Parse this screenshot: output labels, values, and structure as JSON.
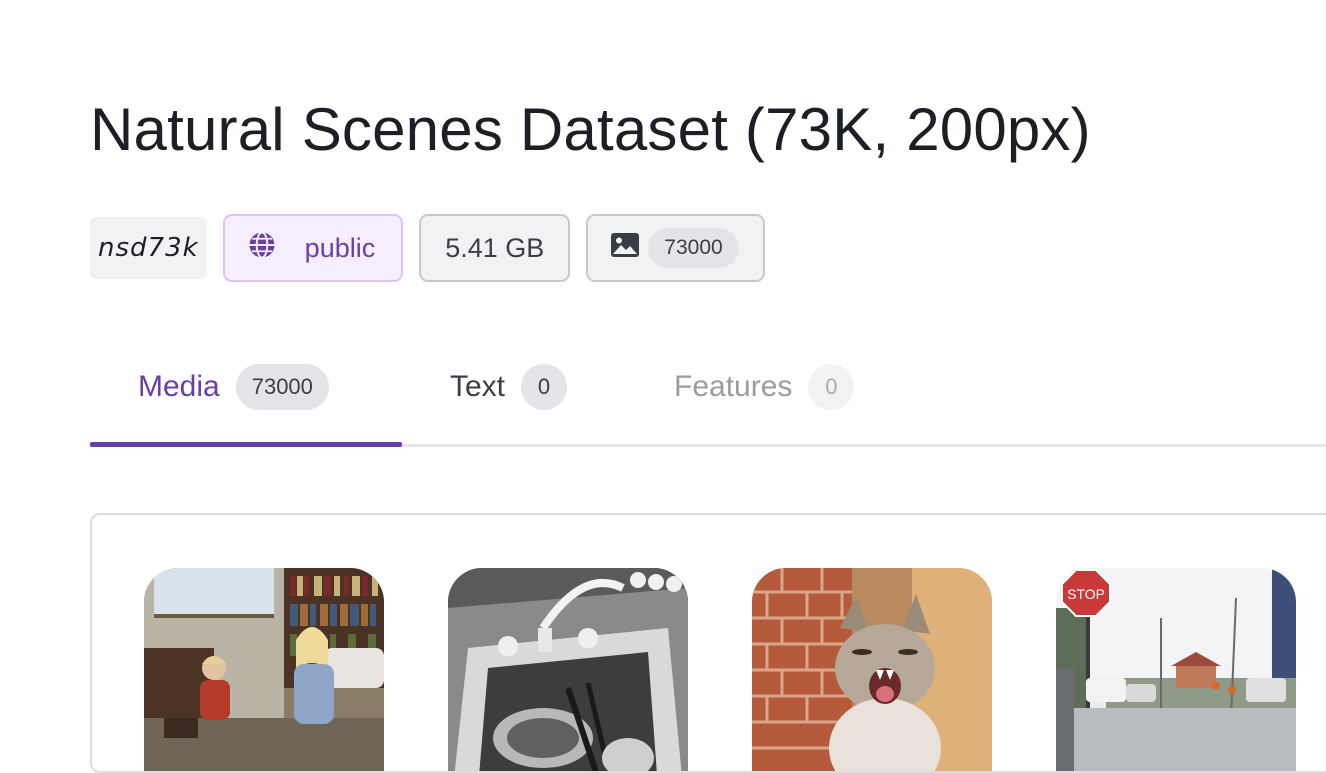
{
  "dataset": {
    "title": "Natural Scenes Dataset (73K, 200px)",
    "slug": "nsd73k",
    "visibility": "public",
    "size": "5.41 GB",
    "image_count": "73000"
  },
  "tabs": [
    {
      "label": "Media",
      "count": "73000",
      "state": "active"
    },
    {
      "label": "Text",
      "count": "0",
      "state": "inactive"
    },
    {
      "label": "Features",
      "count": "0",
      "state": "disabled"
    }
  ],
  "media": {
    "thumbnails": [
      {
        "name": "thumb-children-room"
      },
      {
        "name": "thumb-kitchen-sink"
      },
      {
        "name": "thumb-yawning-cat"
      },
      {
        "name": "thumb-street-stop-sign",
        "sign_text": "STOP"
      }
    ]
  },
  "icons": {
    "visibility_icon": "globe-icon",
    "count_icon": "image-icon"
  },
  "colors": {
    "accent": "#6a3ea7",
    "accent_bg": "#f6eefd",
    "accent_border": "#ddc4f5",
    "neutral_bg": "#f1f2f4",
    "neutral_border": "#c7c9ce"
  }
}
